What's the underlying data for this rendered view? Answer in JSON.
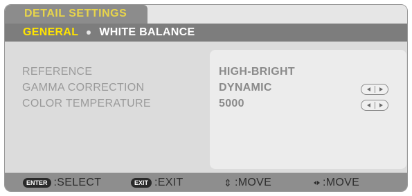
{
  "header": {
    "title": "DETAIL SETTINGS"
  },
  "tabs": [
    {
      "label": "GENERAL",
      "active": true
    },
    {
      "label": "WHITE BALANCE",
      "active": false
    }
  ],
  "settings": [
    {
      "label": "REFERENCE",
      "value": "HIGH-BRIGHT",
      "adjustable": false
    },
    {
      "label": "GAMMA CORRECTION",
      "value": "DYNAMIC",
      "adjustable": true
    },
    {
      "label": "COLOR TEMPERATURE",
      "value": "5000",
      "adjustable": true
    }
  ],
  "footer": {
    "select_key": "ENTER",
    "select_label": ":SELECT",
    "exit_key": "EXIT",
    "exit_label": ":EXIT",
    "move_vertical_label": ":MOVE",
    "move_horizontal_label": ":MOVE"
  },
  "colors": {
    "title_text": "#e8d54a",
    "active_tab": "#ffe400",
    "inactive_tab": "#ffffff",
    "disabled_text": "#9a9a9a"
  },
  "icons": {
    "adjust": "left-right-arrows-icon",
    "move_vertical": "up-down-arrows-icon",
    "move_horizontal": "left-right-arrows-icon"
  }
}
